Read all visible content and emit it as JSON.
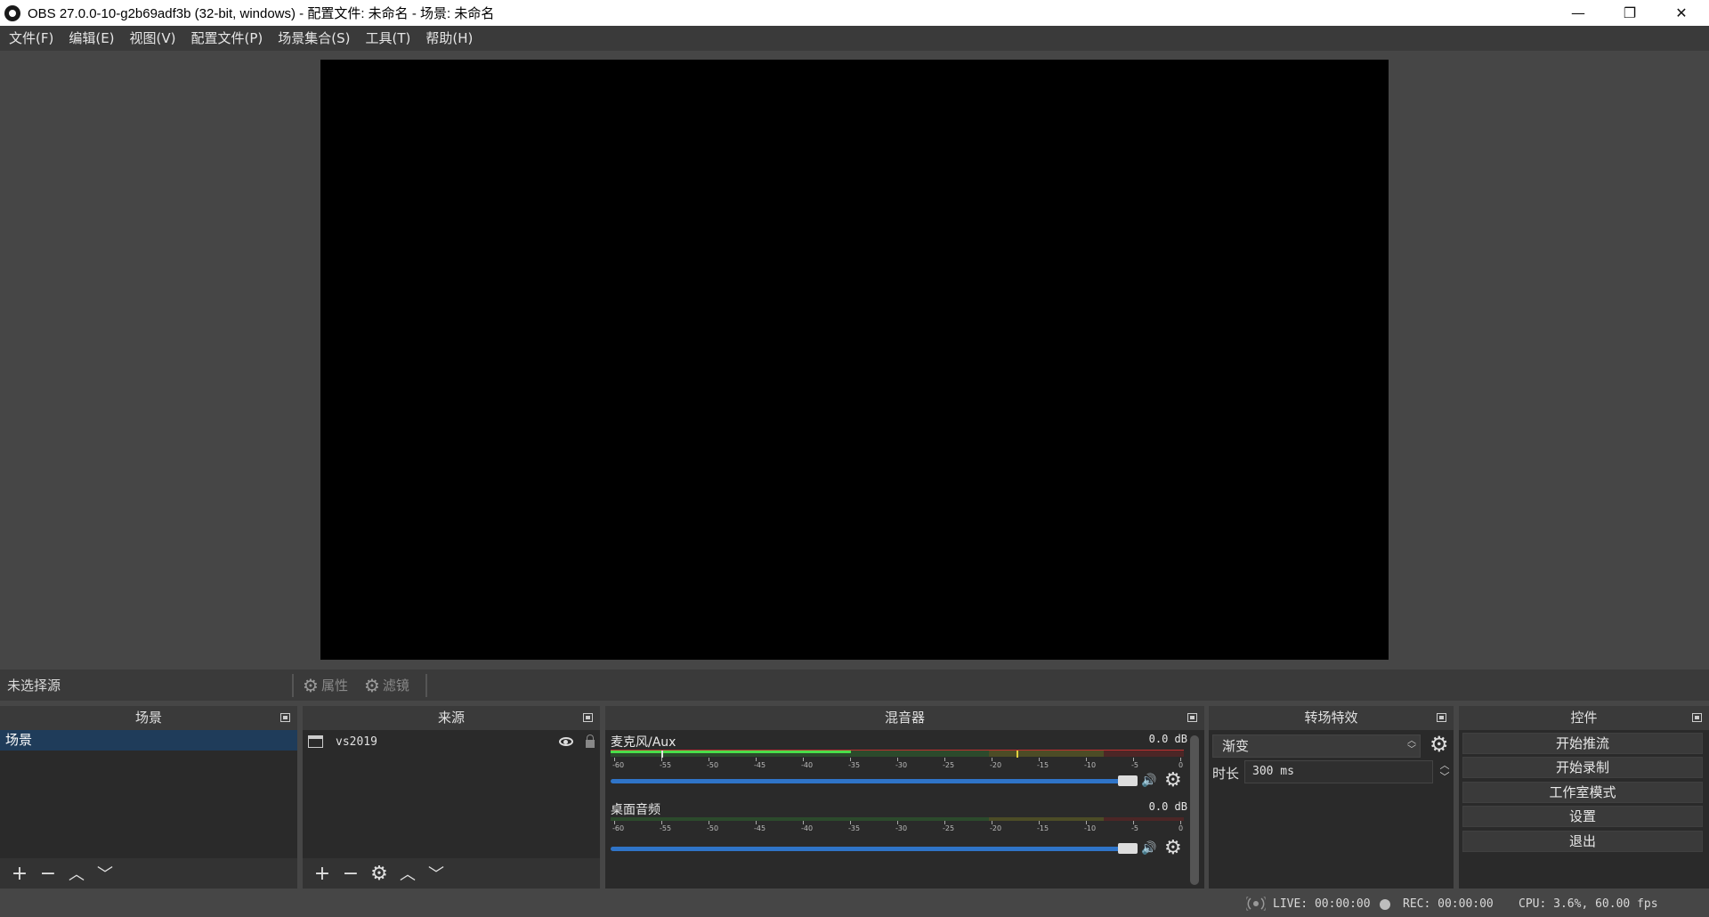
{
  "window": {
    "title": "OBS 27.0.0-10-g2b69adf3b (32-bit, windows) - 配置文件: 未命名 - 场景: 未命名",
    "min_glyph": "—",
    "max_glyph": "❐",
    "close_glyph": "✕"
  },
  "menu": [
    "文件(F)",
    "编辑(E)",
    "视图(V)",
    "配置文件(P)",
    "场景集合(S)",
    "工具(T)",
    "帮助(H)"
  ],
  "context_bar": {
    "no_source": "未选择源",
    "properties": "属性",
    "filters": "滤镜"
  },
  "scenes": {
    "title": "场景",
    "items": [
      "场景"
    ]
  },
  "sources": {
    "title": "来源",
    "items": [
      "vs2019"
    ]
  },
  "mixer": {
    "title": "混音器",
    "channels": [
      {
        "name": "麦克风/Aux",
        "db": "0.0 dB",
        "level": 0.42
      },
      {
        "name": "桌面音频",
        "db": "0.0 dB",
        "level": 0.0
      }
    ],
    "scale_ch1": [
      "-60",
      "-55",
      "-50",
      "-45",
      "-40",
      "-35",
      "-30",
      "-25",
      "-20",
      "-15",
      "-10",
      "-5",
      "0"
    ],
    "scale_ch2": [
      "-60",
      "-55",
      "-50",
      "-45",
      "-40",
      "-35",
      "-30",
      "-25",
      "-20",
      "-15",
      "-10",
      "-5",
      "0"
    ]
  },
  "transitions": {
    "title": "转场特效",
    "selected": "渐变",
    "duration_label": "时长",
    "duration_value": "300 ms"
  },
  "controls": {
    "title": "控件",
    "buttons": [
      "开始推流",
      "开始录制",
      "工作室模式",
      "设置",
      "退出"
    ]
  },
  "status": {
    "live": "LIVE: 00:00:00",
    "rec": "REC: 00:00:00",
    "cpu": "CPU: 3.6%, 60.00 fps"
  },
  "colors": {
    "accent": "#2f74c8",
    "selection": "#1f3c5a",
    "meter_green": "#4ade4a"
  }
}
